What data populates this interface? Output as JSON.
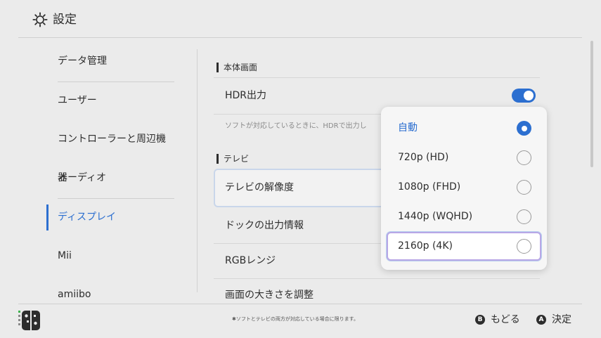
{
  "header": {
    "title": "設定",
    "icon": "gear-icon"
  },
  "sidebar": {
    "items": [
      {
        "label": "データ管理",
        "active": false
      },
      {
        "label": "ユーザー",
        "active": false
      },
      {
        "label": "コントローラーと周辺機器",
        "active": false
      },
      {
        "label": "オーディオ",
        "active": false
      },
      {
        "label": "ディスプレイ",
        "active": true
      },
      {
        "label": "Mii",
        "active": false
      },
      {
        "label": "amiibo",
        "active": false
      }
    ]
  },
  "main": {
    "section_display": "本体画面",
    "hdr_label": "HDR出力",
    "hdr_enabled": true,
    "hdr_desc": "ソフトが対応しているときに、HDRで出力し",
    "section_tv": "テレビ",
    "rows": [
      {
        "label": "テレビの解像度"
      },
      {
        "label": "ドックの出力情報"
      },
      {
        "label": "RGBレンジ"
      },
      {
        "label": "画面の大きさを調整"
      }
    ]
  },
  "popup": {
    "options": [
      {
        "label": "自動",
        "selected": true
      },
      {
        "label": "720p (HD)",
        "selected": false
      },
      {
        "label": "1080p (FHD)",
        "selected": false
      },
      {
        "label": "1440p (WQHD)",
        "selected": false
      },
      {
        "label": "2160p (4K)",
        "selected": false,
        "focused": true
      }
    ]
  },
  "footer": {
    "note": "✱ソフトとテレビの両方が対応している場合に限ります。",
    "back_key": "B",
    "back_label": "もどる",
    "ok_key": "A",
    "ok_label": "決定"
  },
  "colors": {
    "accent": "#2c6fd0",
    "background": "#ebebeb",
    "text": "#2d2d2d"
  }
}
